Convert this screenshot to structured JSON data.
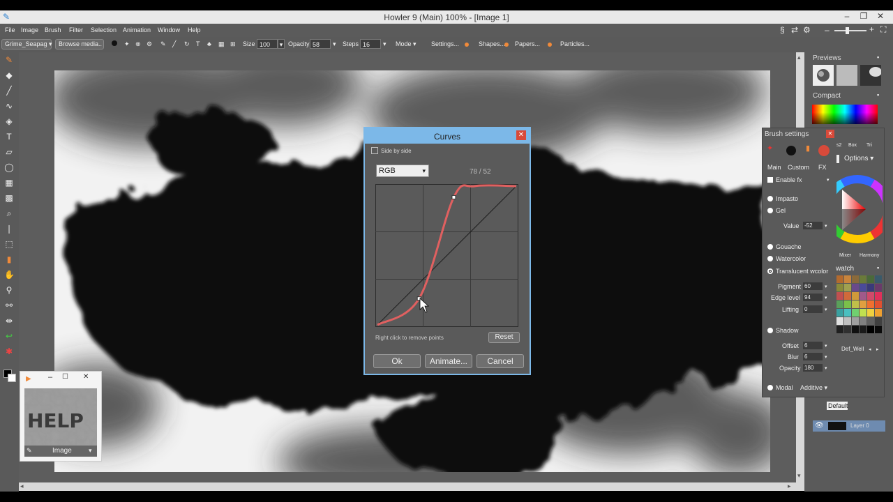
{
  "window": {
    "title": "Howler 9  (Main)   100%   - [Image 1]"
  },
  "menu": [
    "File",
    "Image",
    "Brush",
    "Filter",
    "Selection",
    "Animation",
    "Window",
    "Help"
  ],
  "toolbar": {
    "preset": "Grime_Seapag",
    "browse": "Browse media..",
    "size_label": "Size",
    "size_value": "100",
    "opacity_label": "Opacity",
    "opacity_value": "58",
    "steps_label": "Steps",
    "steps_value": "16",
    "mode_label": "Mode",
    "settings": "Settings...",
    "shapes": "Shapes...",
    "papers": "Papers...",
    "particles": "Particles..."
  },
  "curves": {
    "title": "Curves",
    "side_by_side": "Side by side",
    "channel": "RGB",
    "readout": "78 / 52",
    "hint": "Right click to remove points",
    "reset": "Reset",
    "ok": "Ok",
    "animate": "Animate...",
    "cancel": "Cancel",
    "points": [
      [
        0,
        0
      ],
      [
        0.3,
        0.19
      ],
      [
        0.55,
        0.92
      ],
      [
        0.7,
        1
      ],
      [
        1,
        1
      ]
    ]
  },
  "right": {
    "previews": "Previews",
    "compact": "Compact",
    "swatch": "watch",
    "swatch_set": "Def_Well",
    "mixer": "Mixer",
    "harmony": "Harmony",
    "layers_preset": "Default",
    "layer_name": "Layer 0"
  },
  "brush": {
    "title": "Brush settings",
    "tabs": [
      "Main",
      "Custom",
      "FX"
    ],
    "side_tabs": [
      "s2",
      "Box",
      "Tri"
    ],
    "options": "Options",
    "enable_fx": "Enable fx",
    "impasto": "Impasto",
    "gel": "Gel",
    "value_label": "Value",
    "value": "-52",
    "gouache": "Gouache",
    "watercolor": "Watercolor",
    "translucent": "Translucent wcolor",
    "pigment_label": "Pigment",
    "pigment": "60",
    "edge_label": "Edge level",
    "edge": "94",
    "lifting_label": "Lifting",
    "lifting": "0",
    "shadow": "Shadow",
    "offset_label": "Offset",
    "offset": "6",
    "blur_label": "Blur",
    "blur": "6",
    "sh_opacity_label": "Opacity",
    "sh_opacity": "180",
    "modal": "Modal",
    "blend": "Additive"
  },
  "navigator": {
    "label": "Image",
    "thumb_text": "HELP"
  },
  "colors": {
    "accent": "#7cb8e8",
    "curve": "#e06060",
    "close": "#d84a3a"
  }
}
